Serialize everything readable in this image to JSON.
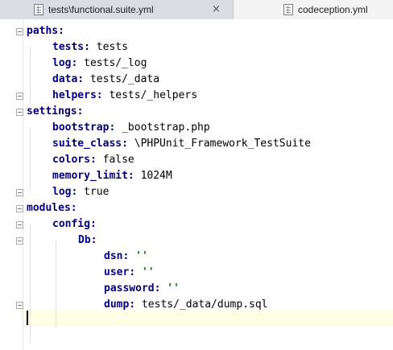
{
  "tabs": [
    {
      "label": "tests\\functional.suite.yml",
      "active": true,
      "icon": "yaml-file-icon"
    },
    {
      "label": "codeception.yml",
      "active": false,
      "icon": "yaml-file-icon"
    }
  ],
  "close_glyph": "×",
  "colors": {
    "key": "#000080",
    "string": "#008000",
    "caret_line": "#fffde6"
  },
  "lines": [
    {
      "indent": 0,
      "key": "paths:",
      "value": ""
    },
    {
      "indent": 1,
      "key": "tests:",
      "value": " tests"
    },
    {
      "indent": 1,
      "key": "log:",
      "value": " tests/_log"
    },
    {
      "indent": 1,
      "key": "data:",
      "value": " tests/_data"
    },
    {
      "indent": 1,
      "key": "helpers:",
      "value": " tests/_helpers"
    },
    {
      "indent": 0,
      "key": "settings:",
      "value": ""
    },
    {
      "indent": 1,
      "key": "bootstrap:",
      "value": " _bootstrap.php"
    },
    {
      "indent": 1,
      "key": "suite_class:",
      "value": " \\PHPUnit_Framework_TestSuite"
    },
    {
      "indent": 1,
      "key": "colors:",
      "value": " false"
    },
    {
      "indent": 1,
      "key": "memory_limit:",
      "value": " 1024M"
    },
    {
      "indent": 1,
      "key": "log:",
      "value": " true"
    },
    {
      "indent": 0,
      "key": "modules:",
      "value": ""
    },
    {
      "indent": 1,
      "key": "config:",
      "value": ""
    },
    {
      "indent": 2,
      "key": "Db:",
      "value": ""
    },
    {
      "indent": 3,
      "key": "dsn:",
      "str": " ''"
    },
    {
      "indent": 3,
      "key": "user:",
      "str": " ''"
    },
    {
      "indent": 3,
      "key": "password:",
      "str": " ''"
    },
    {
      "indent": 3,
      "key": "dump:",
      "value": " tests/_data/dump.sql"
    }
  ]
}
